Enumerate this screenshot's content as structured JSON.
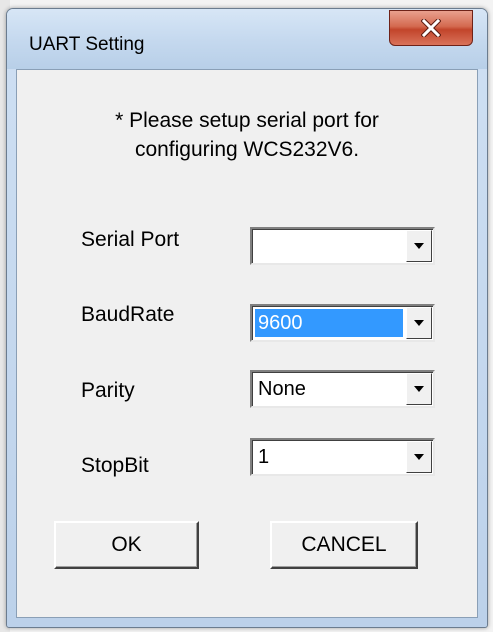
{
  "window": {
    "title": "UART Setting",
    "close_icon": "close-x-icon"
  },
  "prompt": {
    "line1": "* Please setup serial port for",
    "line2": "configuring WCS232V6."
  },
  "fields": {
    "serial_port": {
      "label": "Serial Port",
      "value": ""
    },
    "baud_rate": {
      "label": "BaudRate",
      "value": "9600"
    },
    "parity": {
      "label": "Parity",
      "value": "None"
    },
    "stop_bit": {
      "label": "StopBit",
      "value": "1"
    }
  },
  "buttons": {
    "ok": "OK",
    "cancel": "CANCEL"
  },
  "colors": {
    "selection": "#3399ff",
    "close_button": "#c2452b",
    "title_gradient_top": "#d7e6f6"
  }
}
